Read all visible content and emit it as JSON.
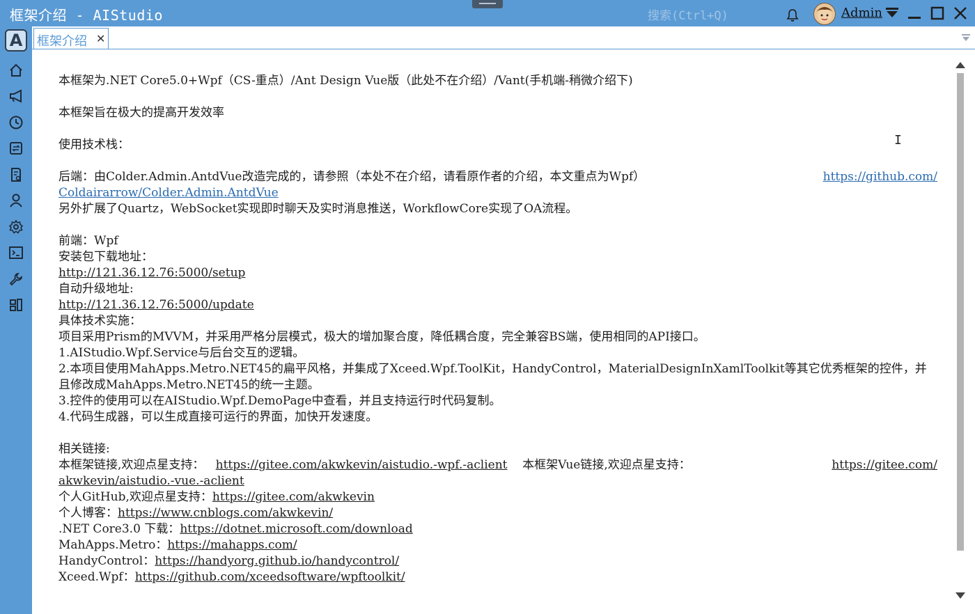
{
  "window": {
    "title": "框架介绍 - AIStudio",
    "search_placeholder": "搜索(Ctrl+Q)",
    "username": "Admin"
  },
  "sidebar": {
    "logo": "A",
    "items": [
      "home-icon",
      "megaphone-icon",
      "clock-icon",
      "refresh-icon",
      "file-icon",
      "user-icon",
      "gear-icon",
      "terminal-icon",
      "wrench-icon",
      "apps-icon"
    ]
  },
  "tabs": [
    {
      "label": "框架介绍",
      "close": "✕"
    }
  ],
  "colors": {
    "accent": "#5b9bd5",
    "link_blue": "#2a6bb0"
  },
  "content": {
    "intro": "本框架为.NET Core5.0+Wpf（CS-重点）/Ant Design Vue版（此处不在介绍）/Vant(手机端-稍微介绍下)",
    "goal": "本框架旨在极大的提高开发效率",
    "stack_heading": "使用技术栈：",
    "backend_text": "后端：由Colder.Admin.AntdVue改造完成的，请参照（本处不在介绍，请看原作者的介绍，本文重点为Wpf）",
    "backend_link_1": "https://github.com/",
    "backend_link_2": "Coldairarrow/Colder.Admin.AntdVue",
    "backend_ext": "另外扩展了Quartz，WebSocket实现即时聊天及实时消息推送，WorkflowCore实现了OA流程。",
    "frontend": "前端：Wpf",
    "install_label": "安装包下载地址：",
    "install_url": "http://121.36.12.76:5000/setup",
    "update_label": "自动升级地址:",
    "update_url": "http://121.36.12.76:5000/update",
    "impl_heading": "具体技术实施：",
    "impl_desc": "项目采用Prism的MVVM，并采用严格分层模式，极大的增加聚合度，降低耦合度，完全兼容BS端，使用相同的API接口。",
    "item1": "1.AIStudio.Wpf.Service与后台交互的逻辑。",
    "item2": "2.本项目使用MahApps.Metro.NET45的扁平风格，并集成了Xceed.Wpf.ToolKit，HandyControl，MaterialDesignInXamlToolkit等其它优秀框架的控件，并且修改成MahApps.Metro.NET45的统一主题。",
    "item3": "3.控件的使用可以在AIStudio.Wpf.DemoPage中查看，并且支持运行时代码复制。",
    "item4": "4.代码生成器，可以生成直接可运行的界面，加快开发速度。",
    "links_heading": "相关链接:",
    "fw_label": "本框架链接,欢迎点星支持：",
    "fw_url": "https://gitee.com/akwkevin/aistudio.-wpf.-aclient",
    "vue_label": "本框架Vue链接,欢迎点星支持：",
    "vue_url_1": "https://gitee.com/",
    "vue_url_2": "akwkevin/aistudio.-vue.-aclient",
    "github_label": "个人GitHub,欢迎点星支持：",
    "github_url": "https://gitee.com/akwkevin",
    "blog_label": "个人博客：",
    "blog_url": "https://www.cnblogs.com/akwkevin/",
    "net_label": ".NET Core3.0 下载：",
    "net_url": "https://dotnet.microsoft.com/download",
    "mahapps_label": "MahApps.Metro：",
    "mahapps_url": "https://mahapps.com/",
    "handy_label": "HandyControl：",
    "handy_url": "https://handyorg.github.io/handycontrol/",
    "xceed_label": "Xceed.Wpf：",
    "xceed_url": "https://github.com/xceedsoftware/wpftoolkit/"
  }
}
